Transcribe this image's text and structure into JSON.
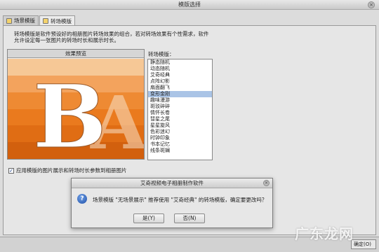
{
  "window": {
    "title": "模版选择",
    "close_glyph": "×"
  },
  "tabs": [
    {
      "label": "场景模版",
      "active": false
    },
    {
      "label": "转场模版",
      "active": true
    }
  ],
  "description": {
    "line1": "转场模版是软件预设好的相册图片转场效果的组合，若对转场效果有个性需求，软件",
    "line2": "允许设定每一张图片的转场时长和展示时长。"
  },
  "preview": {
    "title": "效果预览",
    "letter_main": "B",
    "letter_behind": "A",
    "colors": [
      "#f6c896",
      "#f3a35d",
      "#ee8a33",
      "#ea7a1e",
      "#e06d14",
      "#d2600e"
    ]
  },
  "transitions": {
    "label": "转场模版：",
    "selected_index": 5,
    "items": [
      "静态随机",
      "动态随机",
      "艾奇经典",
      "点阵幻影",
      "扇面翻飞",
      "变形金刚",
      "趣味漫游",
      "斑驳碎碎",
      "情怀长卷",
      "彗星之尾",
      "星星旋风",
      "色彩迷幻",
      "时钟印象",
      "书本记忆",
      "线条斑斓"
    ]
  },
  "apply": {
    "checked": true,
    "label": "应用模版的图片展示和转场时长参数到相册图片"
  },
  "bottom": {
    "ok_stub": "确定(O)"
  },
  "dialog": {
    "title": "艾奇视频电子相册制作软件",
    "icon": "question-icon",
    "icon_glyph": "?",
    "message": "场景模版 \"无场景展示\" 推荐使用 \"艾奇经典\" 的转场模版，确定要更改吗？",
    "yes_label": "是(Y)",
    "no_label": "否(N)"
  },
  "watermark": "广东龙网"
}
